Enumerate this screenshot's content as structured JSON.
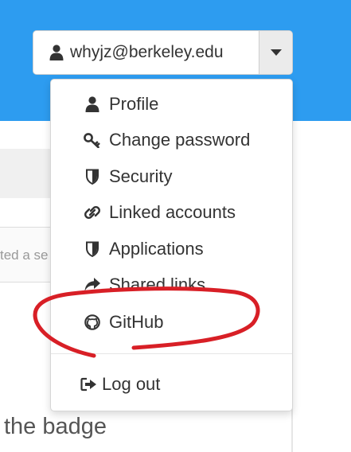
{
  "header": {
    "account_email": "whyjz@berkeley.edu",
    "accent_color": "#2d9cf0"
  },
  "background": {
    "input_fragment": "ted a se",
    "heading_fragment": "the badge"
  },
  "menu": {
    "items": [
      {
        "label": "Profile",
        "icon": "user-icon"
      },
      {
        "label": "Change password",
        "icon": "key-icon"
      },
      {
        "label": "Security",
        "icon": "shield-icon"
      },
      {
        "label": "Linked accounts",
        "icon": "link-icon"
      },
      {
        "label": "Applications",
        "icon": "shield-icon"
      },
      {
        "label": "Shared links",
        "icon": "share-icon"
      },
      {
        "label": "GitHub",
        "icon": "github-icon"
      }
    ],
    "logout_label": "Log out"
  },
  "annotation": {
    "color": "#d81f26",
    "shape": "hand-drawn ellipse around GitHub"
  }
}
